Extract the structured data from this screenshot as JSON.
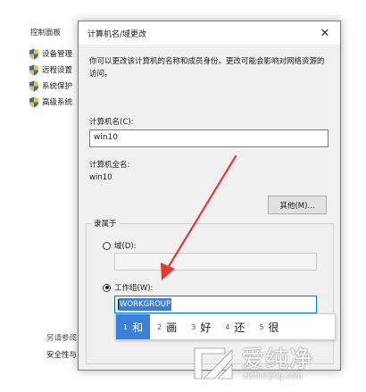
{
  "background": {
    "title": "控制面板",
    "links": [
      {
        "label": "设备管理",
        "icon": "shield-icon"
      },
      {
        "label": "远程设置",
        "icon": "shield-icon"
      },
      {
        "label": "系统保护",
        "icon": "shield-icon"
      },
      {
        "label": "高级系统",
        "icon": "shield-icon"
      }
    ],
    "footer": [
      "另请参阅",
      "安全性与"
    ]
  },
  "dialog": {
    "title": "计算机名/域更改",
    "close_icon": "close-icon",
    "description": "你可以更改该计算机的名称和成员身份。更改可能会影响对网络资源的访问。",
    "computer_name_label": "计算机名(C):",
    "computer_name_value": "win10",
    "full_name_label": "计算机全名:",
    "full_name_value": "win10",
    "more_button": "其他(M)...",
    "member_of_label": "隶属于",
    "domain_label": "域(D):",
    "domain_value": "",
    "workgroup_label": "工作组(W):",
    "workgroup_value_prefix": "",
    "workgroup_value_selected": "WORKGROUP",
    "selected_option": "workgroup"
  },
  "ime": {
    "candidates": [
      {
        "num": "1",
        "char": "和"
      },
      {
        "num": "2",
        "char": "画"
      },
      {
        "num": "3",
        "char": "好"
      },
      {
        "num": "4",
        "char": "还"
      },
      {
        "num": "5",
        "char": "很"
      }
    ]
  },
  "watermark": {
    "cn": "爱纯净",
    "en": "aichunjing.com"
  },
  "colors": {
    "accent": "#3b7fd6",
    "arrow": "#e53935",
    "shield_blue": "#2b6cc4",
    "shield_yellow": "#f2c12e"
  }
}
